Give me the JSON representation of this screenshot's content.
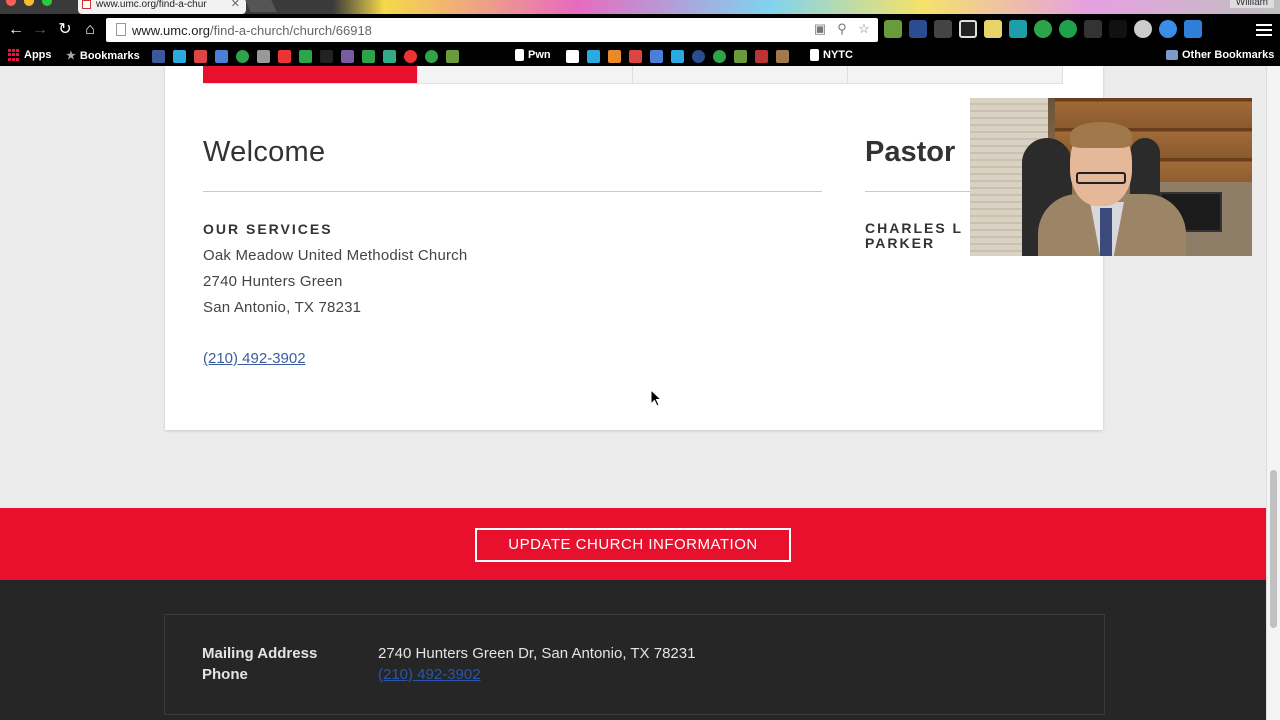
{
  "browser": {
    "tab_title": "www.umc.org/find-a-chur",
    "tab_close": "✕",
    "user_chip": "William",
    "url_host": "www.umc.org",
    "url_path": "/find-a-church/church/66918",
    "bookmarks": {
      "apps": "Apps",
      "bookmarks": "Bookmarks",
      "pwn": "Pwn",
      "nytc": "NYTC",
      "other": "Other Bookmarks"
    }
  },
  "church_card": {
    "welcome_title": "Welcome",
    "services_heading": "OUR SERVICES",
    "church_name": "Oak Meadow United Methodist Church",
    "street": "2740 Hunters Green",
    "city_state_zip": "San Antonio, TX 78231",
    "phone": "(210) 492-3902",
    "pastor_title": "Pastor",
    "pastor_name_line1": "CHARLES L",
    "pastor_name_line2": "PARKER"
  },
  "cta": {
    "update_label": "UPDATE CHURCH INFORMATION"
  },
  "footer": {
    "mailing_label": "Mailing Address",
    "phone_label": "Phone",
    "mailing_value": "2740 Hunters Green Dr, San Antonio, TX 78231",
    "phone_value": "(210) 492-3902"
  },
  "colors": {
    "umc_red": "#e8112d",
    "footer_bg": "#262626",
    "link_blue": "#3a5d9c"
  }
}
